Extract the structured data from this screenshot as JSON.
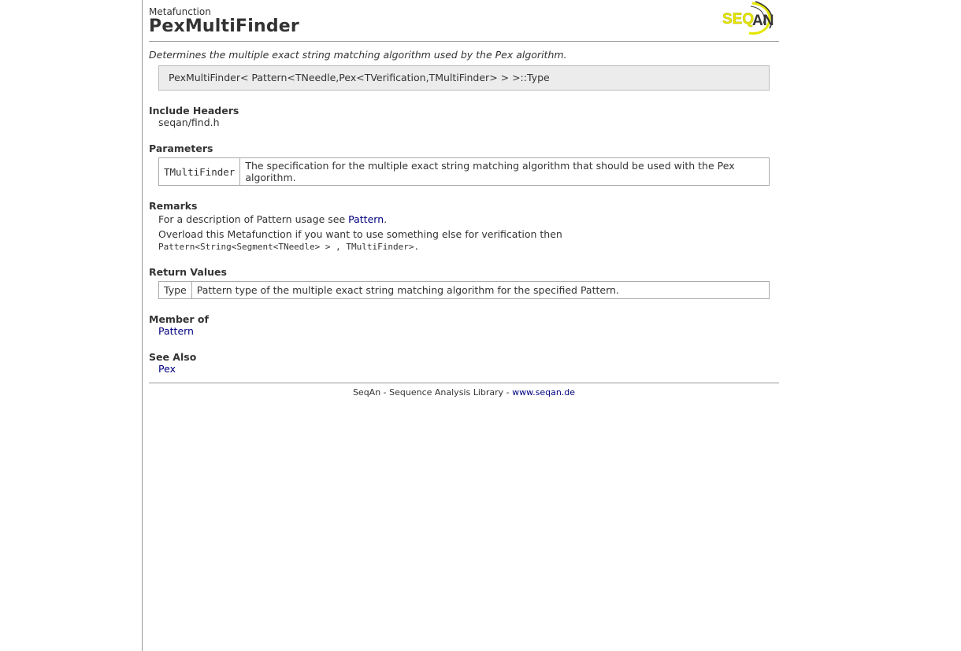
{
  "header": {
    "kind": "Metafunction",
    "title": "PexMultiFinder",
    "logo_text": "SEQAN"
  },
  "summary": "Determines the multiple exact string matching algorithm used by the Pex algorithm.",
  "signature": "PexMultiFinder< Pattern<TNeedle,Pex<TVerification,TMultiFinder> > >::Type",
  "include_headers": {
    "title": "Include Headers",
    "value": "seqan/find.h"
  },
  "parameters": {
    "title": "Parameters",
    "rows": [
      {
        "name": "TMultiFinder",
        "description": "The specification for the multiple exact string matching algorithm that should be used with the Pex algorithm."
      }
    ]
  },
  "remarks": {
    "title": "Remarks",
    "line1_prefix": "For a description of Pattern usage see ",
    "line1_link": "Pattern",
    "line1_suffix": ".",
    "line2": "Overload this Metafunction if you want to use something else for verification then",
    "line3": "Pattern<String<Segment<TNeedle> > , TMultiFinder>."
  },
  "return_values": {
    "title": "Return Values",
    "rows": [
      {
        "name": "Type",
        "description": "Pattern type of the multiple exact string matching algorithm for the specified Pattern."
      }
    ]
  },
  "member_of": {
    "title": "Member of",
    "link": "Pattern"
  },
  "see_also": {
    "title": "See Also",
    "link": "Pex"
  },
  "footer": {
    "text": "SeqAn - Sequence Analysis Library - ",
    "link": "www.seqan.de"
  },
  "colors": {
    "link": "#000080",
    "logo_yellow": "#e6e600",
    "signature_bg": "#ececec"
  }
}
